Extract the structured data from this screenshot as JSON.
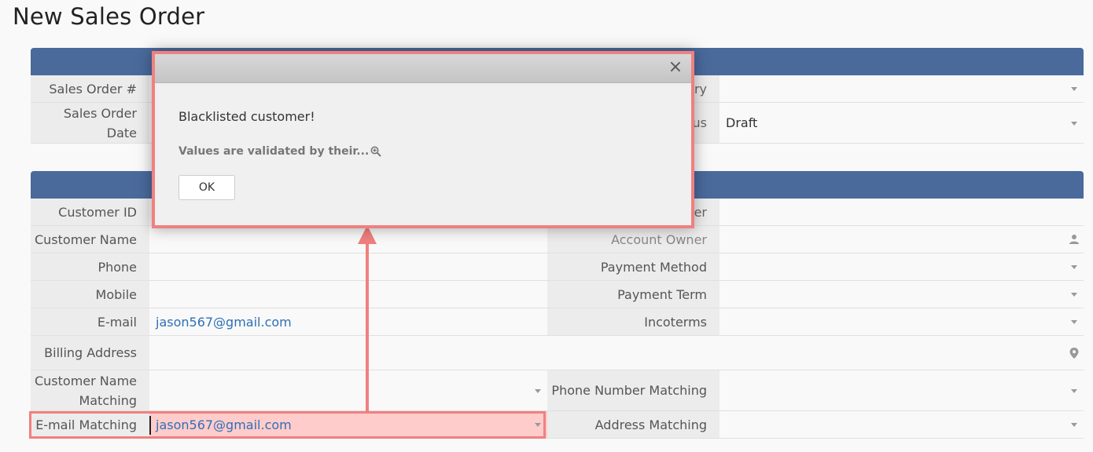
{
  "page": {
    "title": "New Sales Order"
  },
  "section1": {
    "rows": [
      {
        "left_label": "Sales Order #",
        "right_label_partial": "ry",
        "right_value": ""
      },
      {
        "left_label": "Sales Order Date",
        "right_label_partial": "us",
        "right_value": "Draft"
      }
    ]
  },
  "section2": {
    "customer_id_label": "Customer ID",
    "customer_id_right_partial": "er",
    "customer_name_label": "Customer Name",
    "account_owner_label": "Account Owner",
    "phone_label": "Phone",
    "payment_method_label": "Payment Method",
    "mobile_label": "Mobile",
    "payment_term_label": "Payment Term",
    "email_label": "E-mail",
    "email_value": "jason567@gmail.com",
    "incoterms_label": "Incoterms",
    "billing_address_label": "Billing Address",
    "customer_name_matching_label": "Customer Name Matching",
    "phone_number_matching_label": "Phone Number Matching",
    "email_matching_label": "E-mail Matching",
    "email_matching_value": "jason567@gmail.com",
    "address_matching_label": "Address Matching"
  },
  "dialog": {
    "close_symbol": "×",
    "message": "Blacklisted customer!",
    "note": "Values are validated by their...",
    "ok_label": "OK"
  },
  "colors": {
    "section_band": "#4a6a9c",
    "highlight": "#f08080",
    "link": "#2f6fb5"
  }
}
